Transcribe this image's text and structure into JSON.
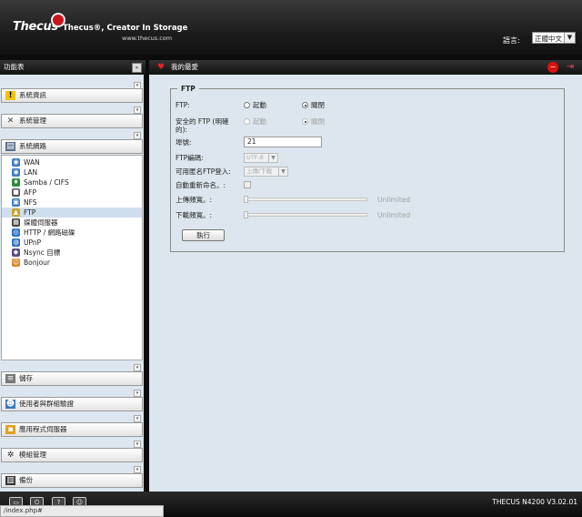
{
  "header": {
    "logo": "Thecus",
    "tagline": "Thecus®, Creator In Storage",
    "url": "www.thecus.com",
    "language_label": "語言:",
    "language_value": "正體中文"
  },
  "sidebar": {
    "title": "功能表",
    "sections": [
      {
        "label": "系統資訊",
        "icon": "info-icon"
      },
      {
        "label": "系統管理",
        "icon": "tools-icon"
      },
      {
        "label": "系統網路",
        "icon": "network-icon"
      },
      {
        "label": "儲存",
        "icon": "storage-icon"
      },
      {
        "label": "使用者與群組驗證",
        "icon": "users-icon"
      },
      {
        "label": "應用程式伺服器",
        "icon": "app-server-icon"
      },
      {
        "label": "模組管理",
        "icon": "module-icon"
      },
      {
        "label": "備份",
        "icon": "backup-icon"
      }
    ],
    "network_items": [
      {
        "label": "WAN",
        "icon": "wan-icon"
      },
      {
        "label": "LAN",
        "icon": "lan-icon"
      },
      {
        "label": "Samba / CIFS",
        "icon": "samba-icon"
      },
      {
        "label": "AFP",
        "icon": "afp-icon"
      },
      {
        "label": "NFS",
        "icon": "nfs-icon"
      },
      {
        "label": "FTP",
        "icon": "ftp-icon",
        "active": true
      },
      {
        "label": "媒體伺服器",
        "icon": "media-server-icon"
      },
      {
        "label": "HTTP / 網路磁碟",
        "icon": "http-icon"
      },
      {
        "label": "UPnP",
        "icon": "upnp-icon"
      },
      {
        "label": "Nsync 目標",
        "icon": "nsync-icon"
      },
      {
        "label": "Bonjour",
        "icon": "bonjour-icon"
      }
    ]
  },
  "main": {
    "title": "我的最愛",
    "legend": "FTP",
    "ftp_label": "FTP:",
    "ftp_on": "起動",
    "ftp_off": "關閉",
    "secure_label": "安全的 FTP (明確的):",
    "secure_on": "起動",
    "secure_off": "關閉",
    "port_label": "埠號:",
    "port_value": "21",
    "encoding_label": "FTP編碼:",
    "encoding_value": "UTF-8",
    "anon_label": "可用匿名FTP登入:",
    "anon_value": "上傳/下載",
    "autorename_label": "自動重新命名。:",
    "upload_label": "上傳頻寬。:",
    "upload_value": "Unlimited",
    "download_label": "下載頻寬。:",
    "download_value": "Unlimited",
    "apply_label": "執行"
  },
  "footer": {
    "version": "THECUS N4200 V3.02.01",
    "status_url": "/index.php#"
  }
}
